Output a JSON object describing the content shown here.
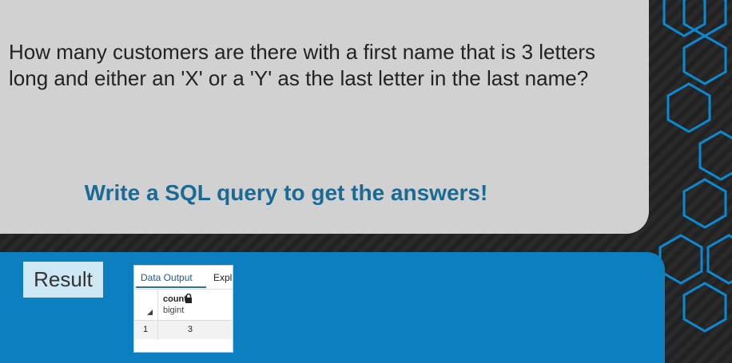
{
  "question": {
    "text": "How many customers are there with a first name that is 3 letters long and either an 'X' or a 'Y' as the last letter in the last name?",
    "cta": "Write a SQL query to get the answers!"
  },
  "result": {
    "label": "Result",
    "tabs": [
      "Data Output",
      "Expl"
    ],
    "column": {
      "name": "count",
      "type": "bigint"
    },
    "rows": [
      {
        "num": "1",
        "value": "3"
      }
    ]
  },
  "colors": {
    "question_bg": "#d2d1d2",
    "cta": "#1b6a93",
    "result_bg": "#0b7fbf",
    "hex_outline": "#0b8ad4"
  },
  "icons": [
    "lock-icon",
    "sort-icon"
  ]
}
